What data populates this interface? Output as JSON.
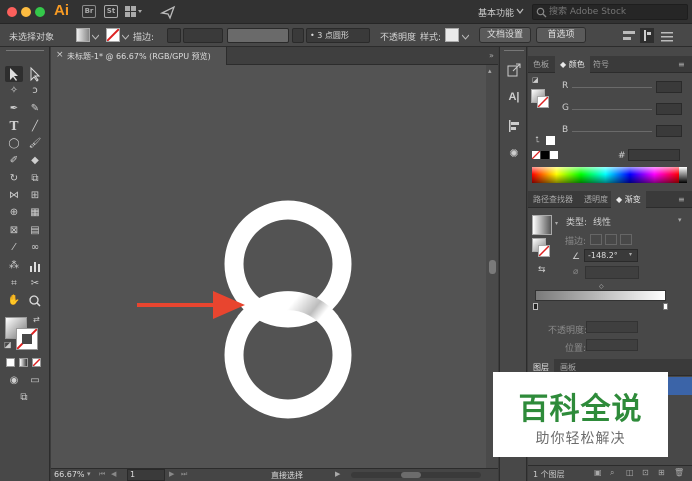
{
  "app": {
    "logo_text": "Ai",
    "workspace": "基本功能",
    "search_placeholder": "搜索 Adobe Stock"
  },
  "titlebar": {
    "icon_br": "Br",
    "icon_st": "St"
  },
  "control_bar": {
    "selection_label": "未选择对象",
    "stroke_label": "描边:",
    "brush_label": "3 点圆形",
    "opacity_label": "不透明度",
    "style_label": "样式:",
    "doc_setup_button": "文档设置",
    "preferences_button": "首选项"
  },
  "document": {
    "tab_title": "未标题-1* @ 66.67% (RGB/GPU 预览)",
    "close_glyph": "×"
  },
  "status_bar": {
    "zoom": "66.67%",
    "artboard": "1",
    "tool_status": "直接选择"
  },
  "color_panel": {
    "tabs": [
      "色板",
      "颜色",
      "符号"
    ],
    "active_tab": 1,
    "channels": [
      "R",
      "G",
      "B"
    ],
    "hex_label": "#"
  },
  "gradient_panel": {
    "tabs": [
      "路径查找器",
      "透明度",
      "渐变"
    ],
    "active_tab": 2,
    "type_label": "类型:",
    "type_value": "线性",
    "stroke_label": "描边:",
    "angle_value": "-148.2°",
    "opacity_label": "不透明度:",
    "position_label": "位置:"
  },
  "layers_panel": {
    "tabs": [
      "图层",
      "画板"
    ],
    "active_tab": 0,
    "footer_count": "1 个图层"
  },
  "watermark": {
    "title": "百科全说",
    "subtitle": "助你轻松解决"
  },
  "colors": {
    "accent_arrow": "#e8452f",
    "ring": "#ffffff",
    "canvas": "#535353",
    "watermark_green": "#2e8b3a"
  }
}
